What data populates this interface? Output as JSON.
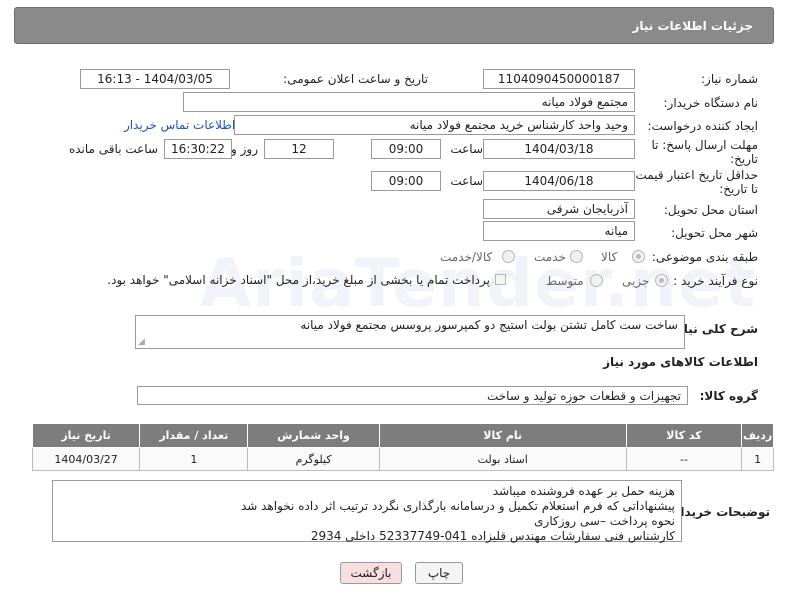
{
  "header": {
    "title": "جزئیات اطلاعات نیاز"
  },
  "fields": {
    "need_number_label": "شماره نیاز:",
    "need_number": "1104090450000187",
    "announce_label": "تاریخ و ساعت اعلان عمومی:",
    "announce_value": "1404/03/05 - 16:13",
    "buyer_org_label": "نام دستگاه خریدار:",
    "buyer_org": "مجتمع فولاد میانه",
    "creator_label": "ایجاد کننده درخواست:",
    "creator": "وحید واحد کارشناس خرید مجتمع فولاد میانه",
    "contact_link": "اطلاعات تماس خریدار",
    "reply_label_1": "مهلت ارسال پاسخ: تا",
    "reply_label_2": "تاریخ:",
    "reply_date": "1404/03/18",
    "time_label": "ساعت",
    "reply_time": "09:00",
    "days_value": "12",
    "days_label": "روز و",
    "remaining_time": "16:30:22",
    "remaining_label": "ساعت باقی مانده",
    "validity_label_1": "حداقل تاریخ اعتبار قیمت:",
    "validity_label_2": "تا تاریخ:",
    "validity_date": "1404/06/18",
    "validity_time": "09:00",
    "province_label": "استان محل تحویل:",
    "province": "آذربایجان شرقی",
    "city_label": "شهر محل تحویل:",
    "city": "میانه",
    "category_label": "طبقه بندی موضوعی:",
    "category_options": [
      "کالا",
      "خدمت",
      "کالا/خدمت"
    ],
    "process_label": "نوع فرآیند خرید :",
    "process_options": [
      "جزیی",
      "متوسط"
    ],
    "payment_note": "پرداخت تمام یا بخشی از مبلغ خرید،از محل \"اسناد خزانه اسلامی\" خواهد بود.",
    "description_label": "شرح کلی نیاز:",
    "description": "ساخت ست کامل تشتن بولت استیج دو کمپرسور پروسس مجتمع فولاد میانه",
    "goods_section_title": "اطلاعات کالاهای مورد نیاز",
    "goods_group_label": "گروه کالا:",
    "goods_group": "تجهیزات و قطعات حوزه تولید و ساخت"
  },
  "table": {
    "headers": [
      "ردیف",
      "کد کالا",
      "نام کالا",
      "واحد شمارش",
      "تعداد / مقدار",
      "تاریخ نیاز"
    ],
    "rows": [
      [
        "1",
        "--",
        "استاد بولت",
        "کیلوگرم",
        "1",
        "1404/03/27"
      ]
    ]
  },
  "notes": {
    "label": "توضیحات خریدار:",
    "lines": [
      "هزینه حمل بر عهده فروشنده میباشد",
      "پیشنهاداتی که فرم استعلام تکمیل و درسامانه بارگذاری نگردد ترتیب اثر داده نخواهد شد",
      "نحوه پرداخت –سی روزکاری",
      "کارشناس فنی سفارشات مهندس قلیزاده   041-52337749  داخلی 2934"
    ]
  },
  "buttons": {
    "back": "بازگشت",
    "print": "چاپ"
  },
  "watermark": "AriaTender.net",
  "colors": {
    "titlebar": "#8a8a8a",
    "table_header": "#7d7d7d",
    "link": "#1a55c0",
    "back_button_bg": "#f8dede"
  }
}
